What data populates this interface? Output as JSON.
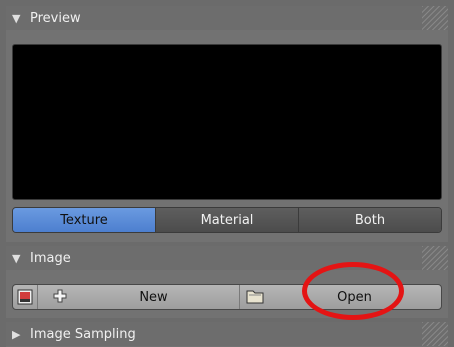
{
  "preview": {
    "header": "Preview",
    "tabs": [
      "Texture",
      "Material",
      "Both"
    ],
    "active_tab": "Texture"
  },
  "image": {
    "header": "Image",
    "new_label": "New",
    "open_label": "Open"
  },
  "image_sampling": {
    "header": "Image Sampling"
  },
  "colors": {
    "active_tab": "#5a8ad8",
    "annotation": "#e41414"
  },
  "icons": [
    "triangle-down-icon",
    "image-browse-icon",
    "plus-icon",
    "folder-icon",
    "triangle-right-icon"
  ]
}
